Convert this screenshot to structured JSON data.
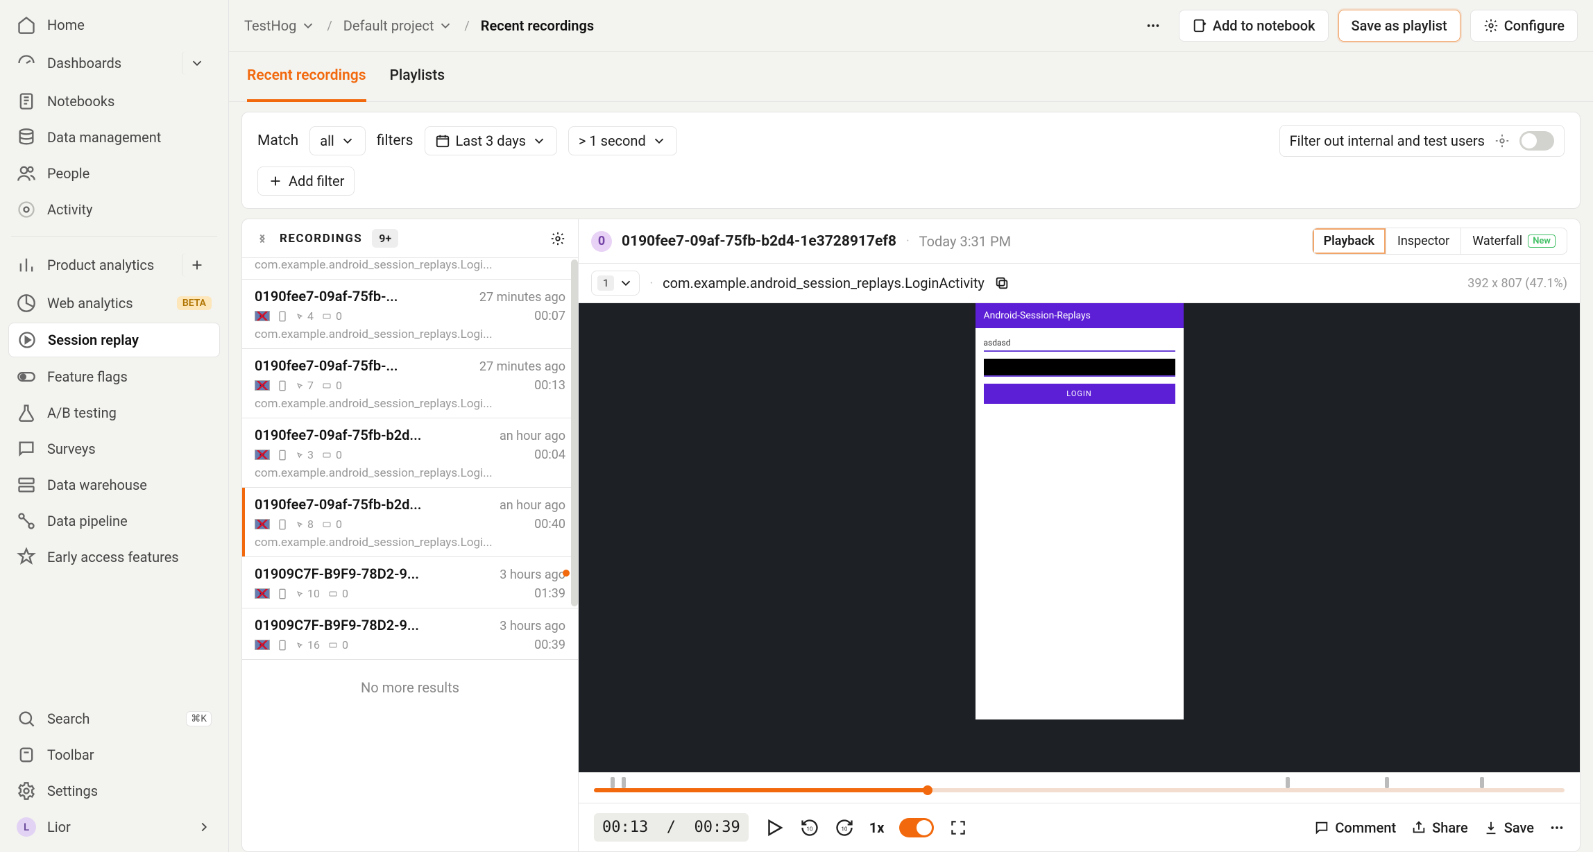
{
  "sidebar": {
    "groups": {
      "top": [
        {
          "icon": "home-icon",
          "label": "Home"
        },
        {
          "icon": "dashboard-icon",
          "label": "Dashboards",
          "trail": "chevron"
        },
        {
          "icon": "notebook-icon",
          "label": "Notebooks"
        },
        {
          "icon": "database-icon",
          "label": "Data management"
        },
        {
          "icon": "people-icon",
          "label": "People"
        },
        {
          "icon": "activity-icon",
          "label": "Activity"
        }
      ],
      "middle": [
        {
          "icon": "bar-chart-icon",
          "label": "Product analytics",
          "trail": "plus"
        },
        {
          "icon": "pie-chart-icon",
          "label": "Web analytics",
          "badge": "BETA"
        },
        {
          "icon": "play-circle-icon",
          "label": "Session replay",
          "active": true
        },
        {
          "icon": "toggle-icon",
          "label": "Feature flags"
        },
        {
          "icon": "flask-icon",
          "label": "A/B testing"
        },
        {
          "icon": "chat-icon",
          "label": "Surveys"
        },
        {
          "icon": "warehouse-icon",
          "label": "Data warehouse"
        },
        {
          "icon": "pipeline-icon",
          "label": "Data pipeline"
        },
        {
          "icon": "star-icon",
          "label": "Early access features"
        }
      ],
      "bottom": [
        {
          "icon": "search-icon",
          "label": "Search",
          "kbd": "⌘K"
        },
        {
          "icon": "mouse-icon",
          "label": "Toolbar"
        },
        {
          "icon": "gear-icon",
          "label": "Settings"
        }
      ],
      "account": {
        "initial": "L",
        "name": "Lior"
      }
    }
  },
  "breadcrumbs": {
    "org": "TestHog",
    "project": "Default project",
    "page": "Recent recordings"
  },
  "header_actions": {
    "notebook": "Add to notebook",
    "playlist": "Save as playlist",
    "configure": "Configure"
  },
  "tabs": {
    "items": [
      "Recent recordings",
      "Playlists"
    ],
    "active_index": 0
  },
  "filters": {
    "match_label": "Match",
    "match_value": "all",
    "filters_label": "filters",
    "date": "Last 3 days",
    "duration": "> 1 second",
    "add_filter": "Add filter",
    "internal_users": "Filter out internal and test users"
  },
  "recordings": {
    "header": {
      "title": "RECORDINGS",
      "count": "9+"
    },
    "peek_activity": "com.example.android_session_replays.Logi...",
    "items": [
      {
        "id": "0190fee7-09af-75fb-...",
        "ago": "27 minutes ago",
        "clicks": "4",
        "keys": "0",
        "dur": "00:07",
        "act": "com.example.android_session_replays.Logi..."
      },
      {
        "id": "0190fee7-09af-75fb-...",
        "ago": "27 minutes ago",
        "clicks": "7",
        "keys": "0",
        "dur": "00:13",
        "act": "com.example.android_session_replays.Logi..."
      },
      {
        "id": "0190fee7-09af-75fb-b2d...",
        "ago": "an hour ago",
        "clicks": "3",
        "keys": "0",
        "dur": "00:04",
        "act": "com.example.android_session_replays.Logi..."
      },
      {
        "id": "0190fee7-09af-75fb-b2d...",
        "ago": "an hour ago",
        "clicks": "8",
        "keys": "0",
        "dur": "00:40",
        "act": "com.example.android_session_replays.Logi...",
        "selected": true
      },
      {
        "id": "01909C7F-B9F9-78D2-9...",
        "ago": "3 hours ago",
        "clicks": "10",
        "keys": "0",
        "dur": "01:39",
        "dot": true
      },
      {
        "id": "01909C7F-B9F9-78D2-9...",
        "ago": "3 hours ago",
        "clicks": "16",
        "keys": "0",
        "dur": "00:39"
      }
    ],
    "no_more": "No more results"
  },
  "player": {
    "initial": "0",
    "title": "0190fee7-09af-75fb-b2d4-1e3728917ef8",
    "time": "Today 3:31 PM",
    "views": {
      "playback": "Playback",
      "inspector": "Inspector",
      "waterfall": "Waterfall",
      "new": "New"
    },
    "page_number": "1",
    "page_url": "com.example.android_session_replays.LoginActivity",
    "dims": "392 x 807 (47.1%)",
    "device": {
      "appbar": "Android-Session-Replays",
      "field": "asdasd",
      "btn": "LOGIN"
    },
    "controls": {
      "current": "00:13",
      "sep": "/",
      "total": "00:39",
      "speed": "1x",
      "comment": "Comment",
      "share": "Share",
      "save": "Save"
    }
  }
}
